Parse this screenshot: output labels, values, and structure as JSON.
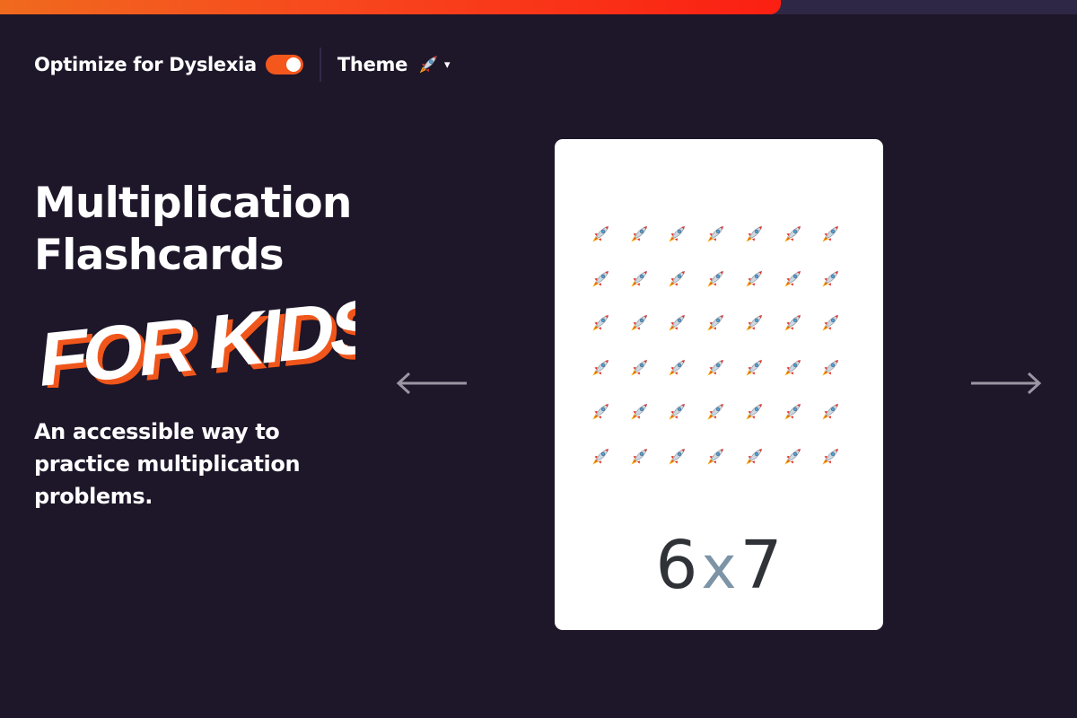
{
  "progress": {
    "value": 0.725,
    "fill_color": "#fb1f12",
    "track_color": "#2e2745"
  },
  "toolbar": {
    "dyslexia_label": "Optimize for Dyslexia",
    "dyslexia_enabled": true,
    "theme_label": "Theme",
    "theme_icon": "rocket-icon",
    "theme_caret": "▾"
  },
  "hero": {
    "title": "Multiplication Flashcards",
    "kids_text": "FOR KIDS!",
    "subtitle": "An accessible way to practice multiplication problems."
  },
  "nav": {
    "prev_icon": "arrow-left-icon",
    "next_icon": "arrow-right-icon"
  },
  "card": {
    "rows": 6,
    "cols": 7,
    "item_icon": "rocket-icon",
    "left_operand": "6",
    "operator": "x",
    "right_operand": "7"
  },
  "colors": {
    "background": "#1e1629",
    "accent": "#f4571c",
    "card": "#ffffff",
    "operator": "#7d93a6"
  }
}
